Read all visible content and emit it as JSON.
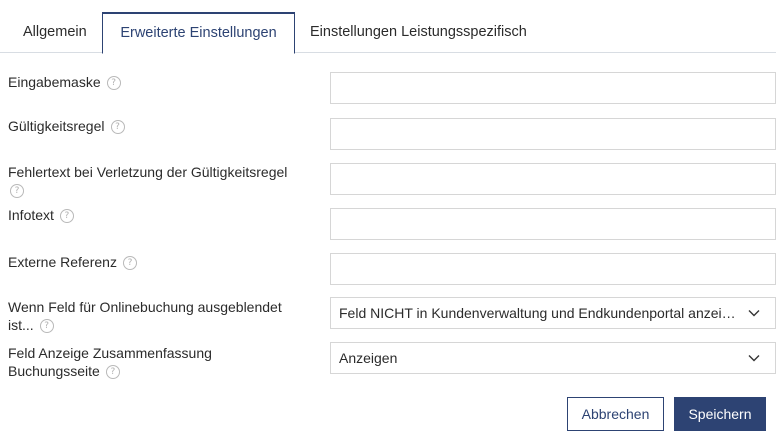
{
  "tabs": [
    {
      "label": "Allgemein",
      "active": false
    },
    {
      "label": "Erweiterte Einstellungen",
      "active": true
    },
    {
      "label": "Einstellungen Leistungsspezifisch",
      "active": false
    }
  ],
  "form": {
    "eingabemaske": {
      "label": "Eingabemaske",
      "value": ""
    },
    "gueltigkeitsregel": {
      "label": "Gültigkeitsregel",
      "value": ""
    },
    "fehlertext": {
      "label": "Fehlertext bei Verletzung der Gültigkeitsregel",
      "value": ""
    },
    "infotext": {
      "label": "Infotext",
      "value": ""
    },
    "externe_referenz": {
      "label": "Externe Referenz",
      "value": ""
    },
    "ausgeblendet": {
      "label_line1": "Wenn Feld für Onlinebuchung ausgeblendet",
      "label_line2": "ist...",
      "selected": "Feld NICHT in Kundenverwaltung und Endkundenportal anzeigen"
    },
    "zusammenfassung": {
      "label_line1": "Feld Anzeige Zusammenfassung",
      "label_line2": "Buchungsseite",
      "selected": "Anzeigen"
    },
    "help_glyph": "?"
  },
  "buttons": {
    "cancel": "Abbrechen",
    "save": "Speichern"
  },
  "colors": {
    "accent": "#2d4373",
    "border": "#d6d6d6",
    "help": "#b9b9b9"
  }
}
